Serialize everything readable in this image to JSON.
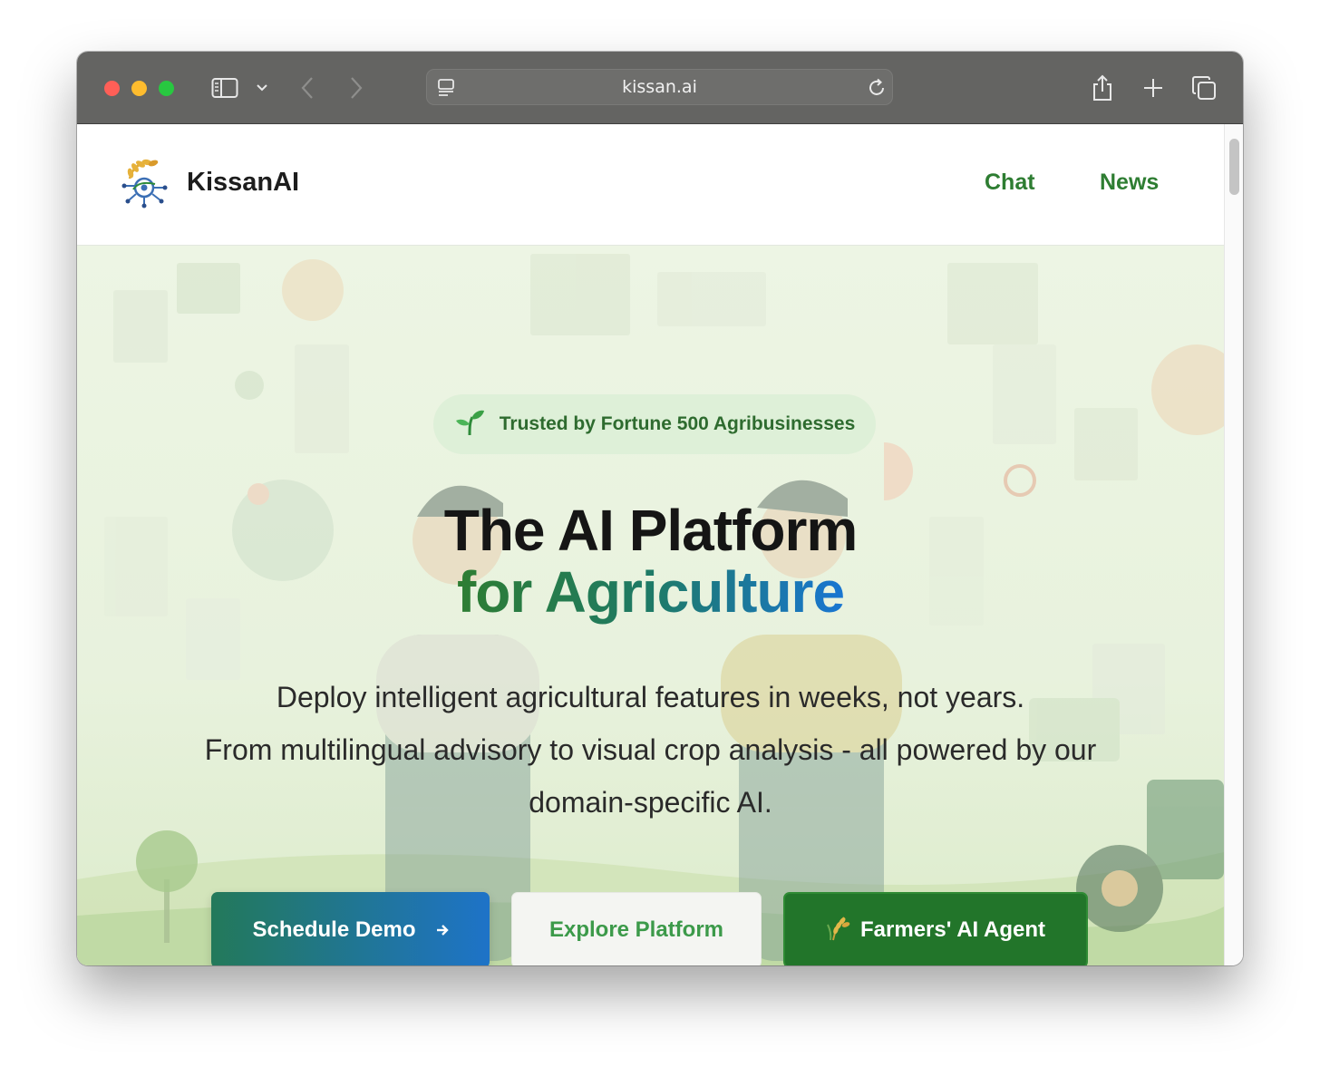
{
  "browser": {
    "url": "kissan.ai"
  },
  "header": {
    "brand": "KissanAI",
    "nav": [
      {
        "label": "Chat"
      },
      {
        "label": "News"
      }
    ]
  },
  "hero": {
    "badge": {
      "icon": "seedling-icon",
      "text": "Trusted by Fortune 500 Agribusinesses"
    },
    "title_line1": "The AI Platform",
    "title_line2": "for Agriculture",
    "subtitle_line1": "Deploy intelligent agricultural features in weeks, not years.",
    "subtitle_line2": "From multilingual advisory to visual crop analysis - all powered by our domain-specific AI.",
    "buttons": {
      "schedule_demo": "Schedule Demo",
      "explore_platform": "Explore Platform",
      "farmers_agent": "Farmers' AI Agent"
    }
  },
  "colors": {
    "accent_green": "#2e7d32",
    "accent_blue": "#1976d2",
    "titlebar": "#646462"
  }
}
